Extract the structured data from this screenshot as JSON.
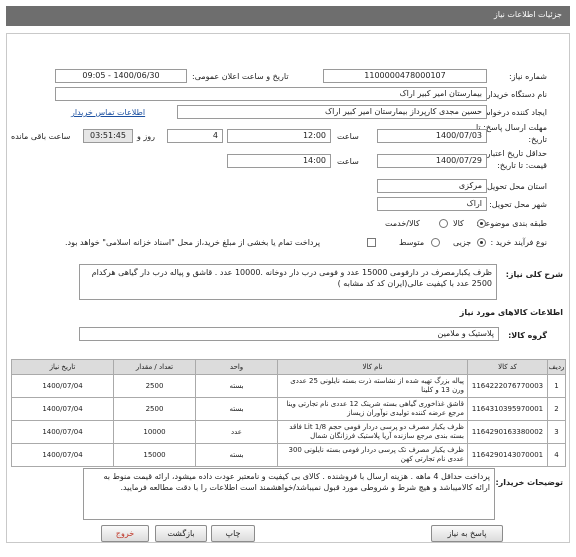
{
  "header": {
    "title": "جزئیات اطلاعات نیاز"
  },
  "form": {
    "need_number_label": "شماره نیاز:",
    "need_number_value": "1100000478000107",
    "announce_label": "تاریخ و ساعت اعلان عمومی:",
    "announce_value": "1400/06/30 - 09:05",
    "buyer_org_label": "نام دستگاه خریدار:",
    "buyer_org_value": "بیمارستان امیر کبیر اراک",
    "requester_label": "ایجاد کننده درخواست:",
    "requester_value": "حسین  مجدی کارپرداز بیمارستان امیر کبیر اراک",
    "contact_link": "اطلاعات تماس خریدار",
    "deadline_label_1": "مهلت ارسال پاسخ: تا",
    "deadline_label_2": "تاریخ:",
    "deadline_date": "1400/07/03",
    "hour_label": "ساعت",
    "deadline_time": "12:00",
    "days_value": "4",
    "days_label": "روز و",
    "remaining_time": "03:51:45",
    "remaining_label": "ساعت باقی مانده",
    "min_price_label_1": "حداقل تاریخ اعتبار",
    "min_price_label_2": "قیمت: تا تاریخ:",
    "validity_date": "1400/07/29",
    "validity_hour_label": "ساعت",
    "validity_time": "14:00",
    "province_label": "استان محل تحویل:",
    "province_value": "مرکزی",
    "city_label": "شهر محل تحویل:",
    "city_value": "اراک",
    "category_label": "طبقه بندی موضوعی:",
    "category_options": [
      "کالا",
      "کالا/خدمت"
    ],
    "process_label": "نوع فرآیند خرید :",
    "process_options": [
      "جزیی",
      "متوسط"
    ],
    "payment_note": "پرداخت تمام یا بخشی از مبلغ خرید،از محل \"اسناد خزانه اسلامی\" خواهد بود."
  },
  "description": {
    "label": "شرح کلی نیاز:",
    "text": "ظرف یکبارمصرف در دارفومی 15000 عدد و فومی درب دار دوخانه .10000 عدد . قاشق و پیاله درب دار گیاهی هرکدام 2500 عدد با کیفیت عالی(ایران کد کد مشابه )"
  },
  "goods": {
    "section_title": "اطلاعات کالاهای مورد نیاز",
    "group_label": "گروه کالا:",
    "group_value": "پلاستیک و ملامین",
    "columns": [
      "ردیف",
      "کد کالا",
      "نام کالا",
      "واحد",
      "تعداد / مقدار",
      "تاریخ نیاز"
    ],
    "rows": [
      {
        "row": "1",
        "code": "1164222076770003",
        "name": "پیاله بزرگ تهیه شده از نشاسته ذرت بسته نایلونی 25 عددی ورن 13 و کلینا",
        "unit": "بسته",
        "qty": "2500",
        "date": "1400/07/04"
      },
      {
        "row": "2",
        "code": "1164310395970001",
        "name": "قاشق غذاخوری گیاهی بسته شرینک 12 عددی نام تجارتی وینا مرجع عرضه کننده تولیدی نوآوران زیساز",
        "unit": "بسته",
        "qty": "2500",
        "date": "1400/07/04"
      },
      {
        "row": "3",
        "code": "1164290163380002",
        "name": "ظرف یکبار مصرف دو پرسی دردار فومی حجم 1/8 Lit فاقد بسته بندی مرجع سازنده آریا پلاستیک فرزانگان شمال",
        "unit": "عدد",
        "qty": "10000",
        "date": "1400/07/04"
      },
      {
        "row": "4",
        "code": "1164290143070001",
        "name": "ظرف یکبار مصرف تک پرسی دردار فومی بسته نایلونی 300 عددی نام تجارتی کهن",
        "unit": "بسته",
        "qty": "15000",
        "date": "1400/07/04"
      }
    ]
  },
  "buyer_notes": {
    "label": "توضیحات خریدار:",
    "text": "پرداخت حداقل 4 ماهه . هزینه ارسال با فروشنده .  کالای بی کیفیت و نامعتبر عودت داده میشود، ارائه قیمت منوط به ارائه کالامیباشد و هیچ شرط و شروطی مورد قبول نمیباشد/خواهشمند است اطلاعات را با دقت مطالعه فرمایید."
  },
  "buttons": {
    "reply": "پاسخ به نیاز",
    "print": "چاپ",
    "back": "بازگشت",
    "exit": "خروج"
  }
}
